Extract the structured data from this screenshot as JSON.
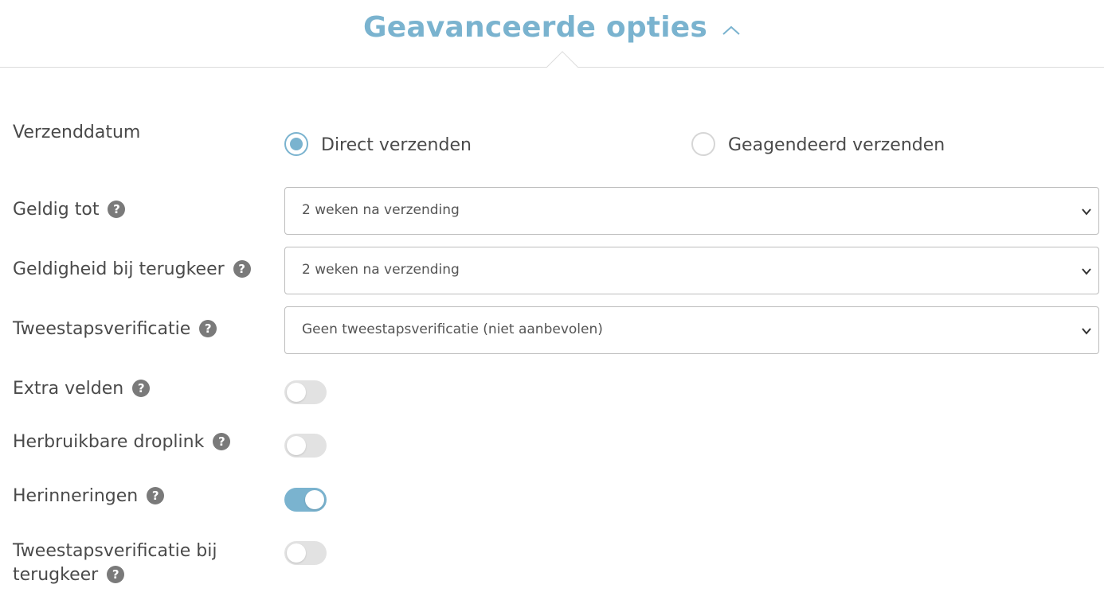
{
  "header": {
    "title": "Geavanceerde opties",
    "collapse_icon": "chevron-up-icon",
    "accent_color": "#7ab3cf"
  },
  "send_date": {
    "label": "Verzenddatum",
    "options": [
      {
        "label": "Direct verzenden",
        "checked": true
      },
      {
        "label": "Geagendeerd verzenden",
        "checked": false
      }
    ]
  },
  "valid_until": {
    "label": "Geldig tot",
    "value": "2 weken na verzending"
  },
  "return_validity": {
    "label": "Geldigheid bij terugkeer",
    "value": "2 weken na verzending"
  },
  "two_step": {
    "label": "Tweestapsverificatie",
    "value": "Geen tweestapsverificatie (niet aanbevolen)"
  },
  "toggles": {
    "extra_fields": {
      "label": "Extra velden",
      "on": false
    },
    "reusable_droplink": {
      "label": "Herbruikbare droplink",
      "on": false
    },
    "reminders": {
      "label": "Herinneringen",
      "on": true
    },
    "two_step_return": {
      "label_line1": "Tweestapsverificatie bij",
      "label_line2": "terugkeer",
      "on": false
    }
  },
  "help_icon": {
    "glyph": "?",
    "name": "help-icon"
  }
}
